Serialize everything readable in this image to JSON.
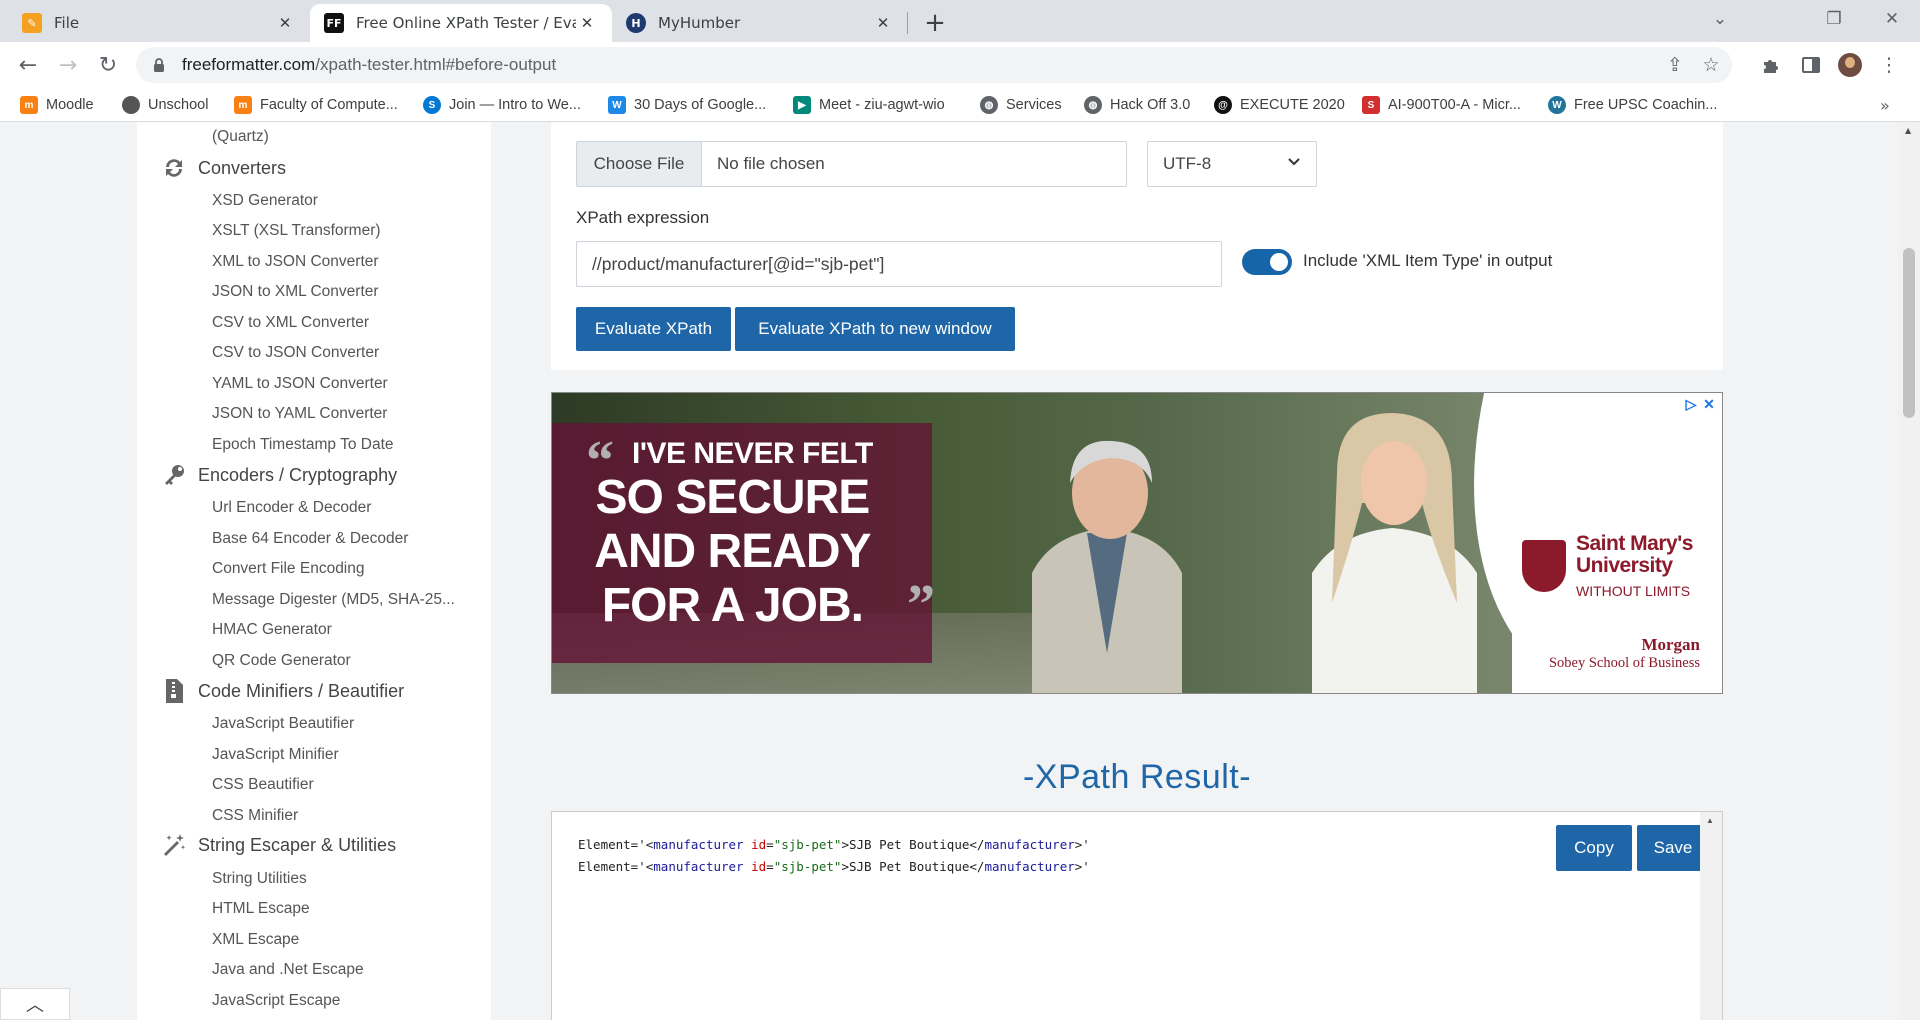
{
  "browser": {
    "tabs": [
      {
        "title": "File",
        "icon": "pencil-icon",
        "color": "#f4a020"
      },
      {
        "title": "Free Online XPath Tester / Evalua",
        "icon": "ff-icon",
        "color": "#111111"
      },
      {
        "title": "MyHumber",
        "icon": "humber-icon",
        "color": "#1e3a6e"
      }
    ],
    "url_host": "freeformatter.com",
    "url_path": "/xpath-tester.html#before-output"
  },
  "bookmarks": [
    {
      "label": "Moodle",
      "icon": "moodle-icon",
      "color": "#f98012"
    },
    {
      "label": "Unschool",
      "icon": "apple-icon",
      "color": "#555555"
    },
    {
      "label": "Faculty of Compute...",
      "icon": "moodle-icon",
      "color": "#f98012"
    },
    {
      "label": "Join — Intro to We...",
      "icon": "skype-icon",
      "color": "#0078d4"
    },
    {
      "label": "30 Days of Google...",
      "icon": "w-icon",
      "color": "#1e88e5"
    },
    {
      "label": "Meet - ziu-agwt-wio",
      "icon": "meet-icon",
      "color": "#00897b"
    },
    {
      "label": "Services",
      "icon": "globe-icon",
      "color": "#5f6368"
    },
    {
      "label": "Hack Off 3.0",
      "icon": "globe-icon",
      "color": "#5f6368"
    },
    {
      "label": "EXECUTE 2020",
      "icon": "spiral-icon",
      "color": "#111111"
    },
    {
      "label": "AI-900T00-A - Micr...",
      "icon": "s-icon",
      "color": "#d32f2f"
    },
    {
      "label": "Free UPSC Coachin...",
      "icon": "wordpress-icon",
      "color": "#21759b"
    }
  ],
  "sidebar": {
    "top_fragment": "(Quartz)",
    "categories": [
      {
        "label": "Converters",
        "icon": "sync-icon",
        "items": [
          "XSD Generator",
          "XSLT (XSL Transformer)",
          "XML to JSON Converter",
          "JSON to XML Converter",
          "CSV to XML Converter",
          "CSV to JSON Converter",
          "YAML to JSON Converter",
          "JSON to YAML Converter",
          "Epoch Timestamp To Date"
        ]
      },
      {
        "label": "Encoders / Cryptography",
        "icon": "key-icon",
        "items": [
          "Url Encoder & Decoder",
          "Base 64 Encoder & Decoder",
          "Convert File Encoding",
          "Message Digester (MD5, SHA-25...",
          "HMAC Generator",
          "QR Code Generator"
        ]
      },
      {
        "label": "Code Minifiers / Beautifier",
        "icon": "file-zip-icon",
        "items": [
          "JavaScript Beautifier",
          "JavaScript Minifier",
          "CSS Beautifier",
          "CSS Minifier"
        ]
      },
      {
        "label": "String Escaper & Utilities",
        "icon": "magic-wand-icon",
        "items": [
          "String Utilities",
          "HTML Escape",
          "XML Escape",
          "Java and .Net Escape",
          "JavaScript Escape"
        ]
      }
    ]
  },
  "form": {
    "choose_file": "Choose File",
    "no_file": "No file chosen",
    "encoding": "UTF-8",
    "xpath_label": "XPath expression",
    "xpath_value": "//product/manufacturer[@id=\"sjb-pet\"]",
    "toggle_on": true,
    "toggle_label": "Include 'XML Item Type' in output",
    "evaluate": "Evaluate XPath",
    "evaluate_new": "Evaluate XPath to new window"
  },
  "ad": {
    "line1": "I'VE NEVER FELT",
    "line2": "SO SECURE",
    "line3": "AND READY",
    "line4": "FOR A JOB.",
    "uni1": "Saint Mary's",
    "uni2": "University",
    "tagline": "WITHOUT LIMITS",
    "school1": "Morgan",
    "school2": "Sobey School of Business"
  },
  "result": {
    "title": "-XPath Result-",
    "lines": [
      {
        "prefix": "Element='<",
        "tag": "manufacturer",
        "attr": "id",
        "eq": "=",
        "val": "\"sjb-pet\"",
        "mid": ">SJB Pet Boutique</",
        "tag2": "manufacturer",
        "suffix": ">'"
      },
      {
        "prefix": "Element='<",
        "tag": "manufacturer",
        "attr": "id",
        "eq": "=",
        "val": "\"sjb-pet\"",
        "mid": ">SJB Pet Boutique</",
        "tag2": "manufacturer",
        "suffix": ">'"
      }
    ],
    "copy": "Copy",
    "save": "Save"
  }
}
